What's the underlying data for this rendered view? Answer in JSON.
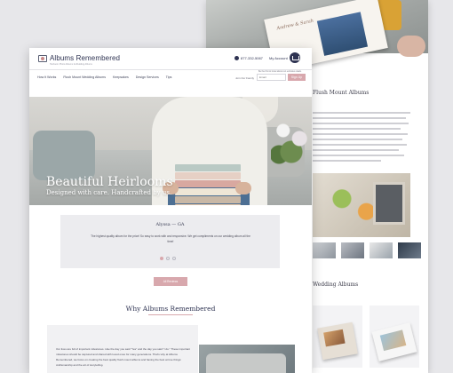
{
  "back_page": {
    "hero_book_script": "Andrew & Sarah",
    "section_title": "Flush Mount Albums",
    "subsection_title": "Wedding Albums"
  },
  "header": {
    "logo_text": "Albums Remembered",
    "logo_tagline": "Heirloom Photo Albums & Wedding Albums",
    "phone": "877-332-5067",
    "account": "My Account",
    "nav_note": "Be the first to know about our exclusive deals."
  },
  "nav": {
    "items": [
      "How It Works",
      "Flush Mount Wedding Albums",
      "Keepsakes",
      "Design Services",
      "Tips"
    ],
    "family_label": "Join Our Family",
    "email_placeholder": "Email",
    "signup_label": "Sign Up"
  },
  "hero": {
    "title": "Beautiful Heirlooms",
    "subtitle": "Designed with care. Handcrafted by us.",
    "book_colors": [
      "#b9c9c4",
      "#e6d0c5",
      "#d8a8a0",
      "#efe6d6",
      "#c9b8a6",
      "#e8c7a8",
      "#d7a785"
    ]
  },
  "testimonial": {
    "name": "Alyssa — GA",
    "text": "The highest quality album for the price! So easy to work with and responsive. We get compliments on our wedding album all the time!",
    "dots": [
      true,
      false,
      false
    ]
  },
  "reviews_button": "All Reviews",
  "why": {
    "title": "Why Albums Remembered",
    "text": "Our lives are full of important milestones. Like the day you said \"Yes\" and the day you said \"I do.\" These important milestones should be captured and shared with loved ones for many generations. That's why at Albums Remembered, we focus on creating the best quality flush mount albums and having the best at true things: craftsmanship and the art of storytelling."
  },
  "colors": {
    "brand_navy": "#2e3352",
    "accent_pink": "#d8a8ad",
    "panel_gray": "#ececef"
  }
}
